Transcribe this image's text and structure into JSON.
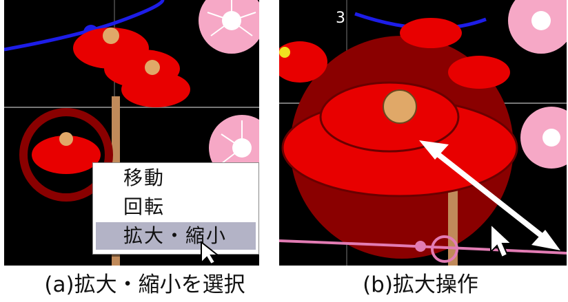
{
  "panel_a": {
    "context_menu": {
      "items": [
        {
          "label": "移動",
          "selected": false
        },
        {
          "label": "回転",
          "selected": false
        },
        {
          "label": "拡大・縮小",
          "selected": true
        }
      ]
    },
    "caption": "(a)拡大・縮小を選択"
  },
  "panel_b": {
    "vertex_label": "3",
    "caption": "(b)拡大操作"
  },
  "colors": {
    "background": "#000000",
    "flower_red": "#e80000",
    "flower_center": "#e0a868",
    "plum_pink": "#f6a8c6",
    "path_blue": "#1d1de8",
    "path_pink": "#e27cb4",
    "selection_circle": "#8a0000",
    "menu_highlight": "#b3b3c6"
  },
  "icons": [
    "mouse-pointer-icon",
    "double-arrow-icon"
  ]
}
